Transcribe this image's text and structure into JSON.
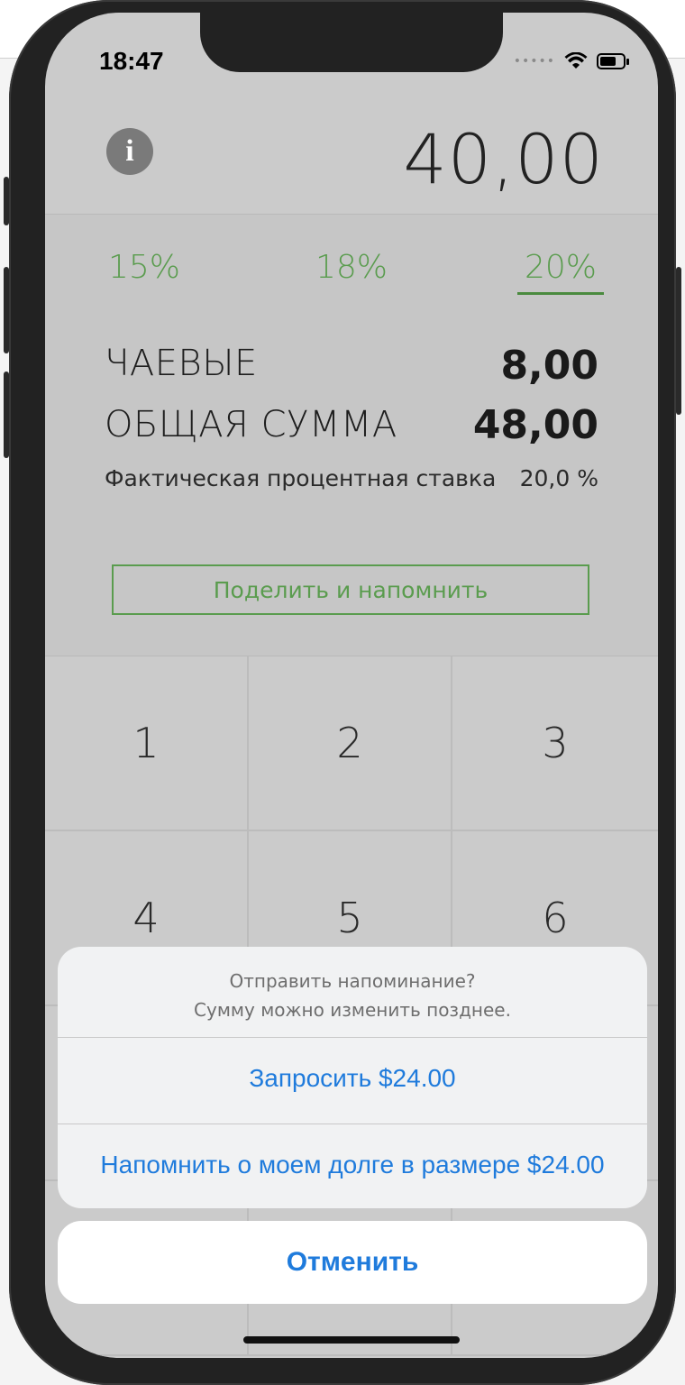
{
  "status": {
    "time": "18:47"
  },
  "bill": {
    "amount": "40,00"
  },
  "tips": {
    "options": [
      "15%",
      "18%",
      "20%"
    ],
    "selected": "20%"
  },
  "summary": {
    "tip_label": "ЧАЕВЫЕ",
    "tip_value": "8,00",
    "total_label": "ОБЩАЯ СУММА",
    "total_value": "48,00",
    "effective_label": "Фактическая процентная ставка",
    "effective_value": "20,0 %"
  },
  "split_button": "Поделить и напомнить",
  "keypad": [
    "1",
    "2",
    "3",
    "4",
    "5",
    "6"
  ],
  "sheet": {
    "title": "Отправить напоминание?",
    "subtitle": "Сумму можно изменить позднее.",
    "actions": [
      "Запросить $24.00",
      "Напомнить о моем долге в размере $24.00"
    ],
    "cancel": "Отменить"
  },
  "colors": {
    "accent_green": "#5a9c4e",
    "ios_blue": "#1f7bdc",
    "screen_bg": "#cbcbcb"
  },
  "icons": [
    "info-icon",
    "wifi-icon",
    "battery-icon"
  ]
}
